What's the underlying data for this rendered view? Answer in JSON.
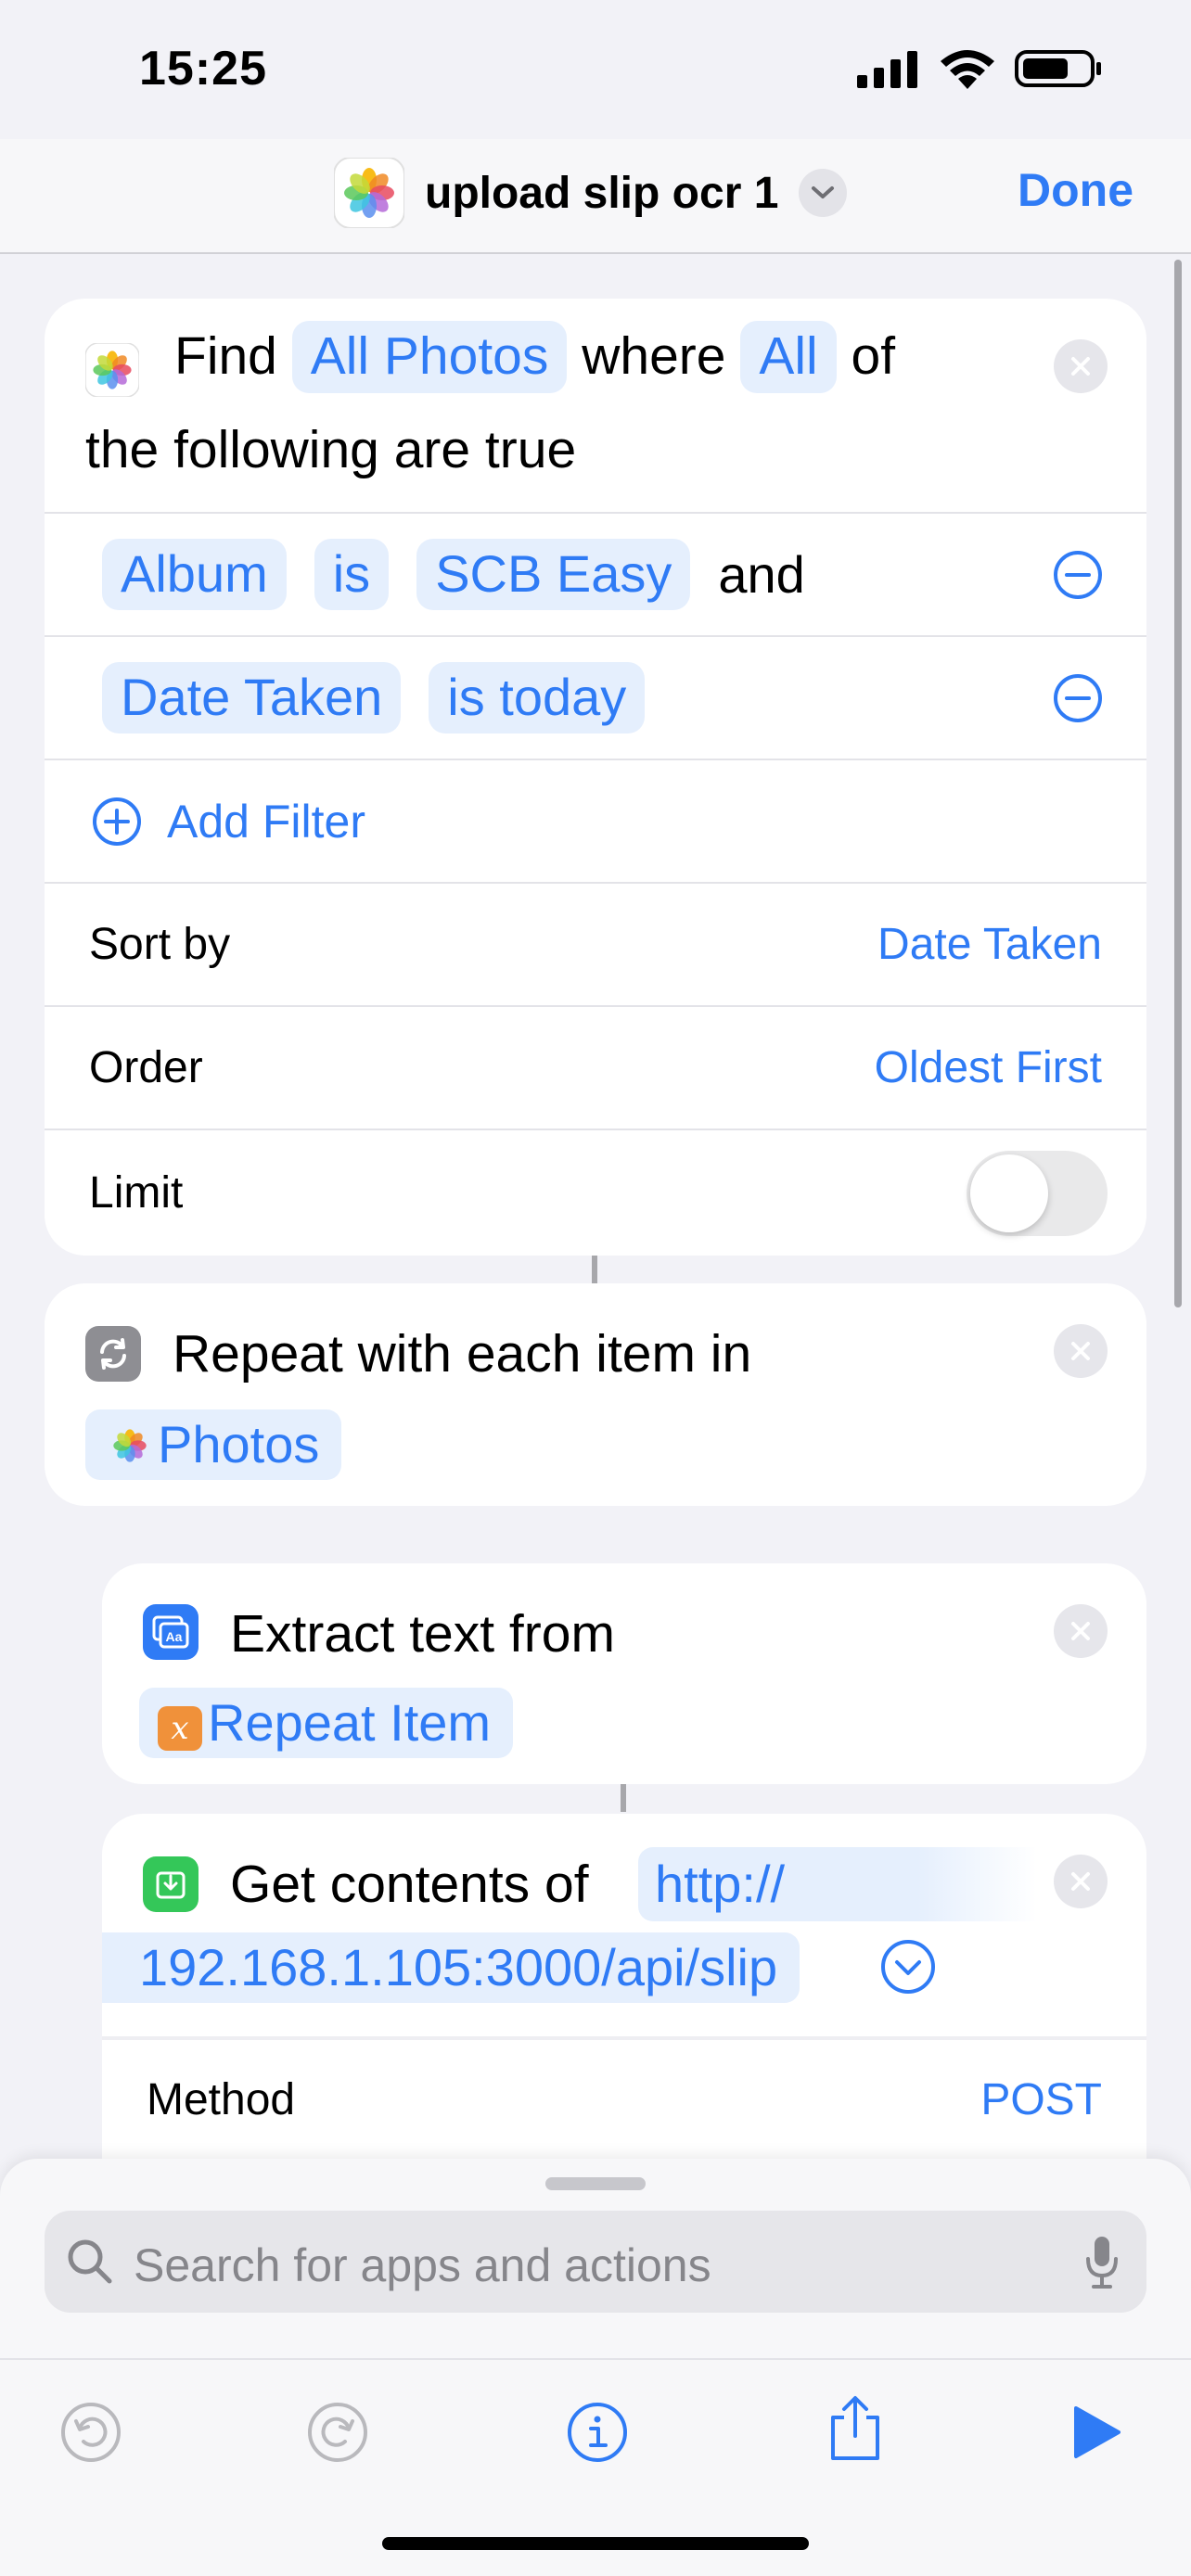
{
  "status_bar": {
    "time": "15:25"
  },
  "nav": {
    "title": "upload slip ocr 1",
    "done_label": "Done"
  },
  "find_action": {
    "word_find": "Find",
    "source": "All Photos",
    "word_where": "where",
    "quantifier": "All",
    "word_of": "of",
    "line2": "the following are true",
    "filters": [
      {
        "property": "Album",
        "operator": "is",
        "value": "SCB Easy",
        "joiner": "and"
      },
      {
        "property": "Date Taken",
        "operator": "is today"
      }
    ],
    "add_filter_label": "Add Filter",
    "sort_by": {
      "label": "Sort by",
      "value": "Date Taken"
    },
    "order": {
      "label": "Order",
      "value": "Oldest First"
    },
    "limit": {
      "label": "Limit",
      "enabled": false
    }
  },
  "repeat_action": {
    "label": "Repeat with each item in",
    "variable": "Photos"
  },
  "extract_action": {
    "label": "Extract text from",
    "variable": "Repeat Item"
  },
  "get_contents_action": {
    "label": "Get contents of",
    "url_part1": "http://",
    "url_part2": "192.168.1.105:3000/api/slip",
    "method_label": "Method",
    "method_value": "POST"
  },
  "search": {
    "placeholder": "Search for apps and actions"
  },
  "toolbar": {
    "buttons": [
      "undo",
      "redo",
      "info",
      "share",
      "play"
    ]
  },
  "colors": {
    "accent": "#2f7bf5",
    "background": "#f2f2f7",
    "card": "#ffffff",
    "token_bg": "#e5effd"
  }
}
